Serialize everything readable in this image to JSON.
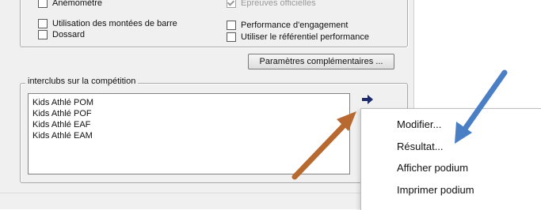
{
  "options": {
    "left": [
      {
        "label": "Anémomètre",
        "checked": false
      },
      {
        "label": "Utilisation des montées de barre",
        "checked": false
      },
      {
        "label": "Dossard",
        "checked": false
      }
    ],
    "right": [
      {
        "label": "Epreuves officielles",
        "checked": true,
        "disabled": true
      },
      {
        "label": "Performance d'engagement",
        "checked": false
      },
      {
        "label": "Utiliser le référentiel performance",
        "checked": false
      }
    ]
  },
  "params_button": "Paramètres complémentaires ...",
  "interclubs": {
    "legend": "interclubs sur la compétition",
    "items": [
      "Kids Athlé POM",
      "Kids Athlé POF",
      "Kids Athlé EAF",
      "Kids Athlé EAM"
    ]
  },
  "context_menu": {
    "items": [
      "Modifier...",
      "Résultat...",
      "Afficher podium",
      "Imprimer podium"
    ]
  },
  "colors": {
    "brown_arrow": "#b8692f",
    "blue_arrow": "#4a7fc6",
    "nav_arrow": "#1f2a6b"
  }
}
